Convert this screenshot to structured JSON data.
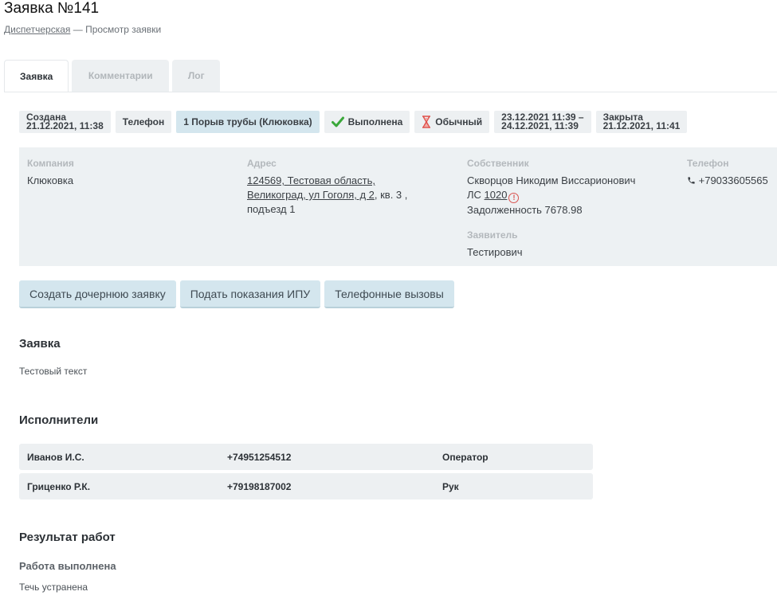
{
  "page": {
    "title": "Заявка №141"
  },
  "breadcrumb": {
    "link": "Диспетчерская",
    "separator": "—",
    "current": "Просмотр заявки"
  },
  "tabs": [
    {
      "label": "Заявка",
      "active": true
    },
    {
      "label": "Комментарии",
      "active": false
    },
    {
      "label": "Лог",
      "active": false
    }
  ],
  "badges": {
    "created_label": "Создана",
    "created_value": "21.12.2021, 11:38",
    "source": "Телефон",
    "category": "1 Порыв трубы (Клюковка)",
    "status": "Выполнена",
    "priority": "Обычный",
    "period_from": "23.12.2021 11:39 –",
    "period_to": "24.12.2021, 11:39",
    "closed_label": "Закрыта",
    "closed_value": "21.12.2021, 11:41",
    "status_icon": "check-icon",
    "priority_icon": "hourglass-icon",
    "status_color": "#3aa83a",
    "priority_color": "#e0504a"
  },
  "info": {
    "company_label": "Компания",
    "company": "Клюковка",
    "address_label": "Адрес",
    "address_link_1": "124569, Тестовая область,",
    "address_link_2": "Великоград, ул Гоголя, д 2",
    "address_rest_1": ", кв. 3 ,",
    "address_rest_2": "подъезд 1",
    "owner_label": "Собственник",
    "owner_name": "Скворцов Никодим Виссарионович",
    "account_prefix": "ЛС",
    "account_number": "1020",
    "debt": "Задолженность 7678.98",
    "applicant_label": "Заявитель",
    "applicant": "Тестирович",
    "phone_label": "Телефон",
    "phone": "+79033605565",
    "phone_icon": "phone-icon"
  },
  "actions": {
    "create_child": "Создать дочернюю заявку",
    "submit_readings": "Подать показания ИПУ",
    "phone_calls": "Телефонные вызовы"
  },
  "request_section": {
    "heading": "Заявка",
    "text": "Тестовый текст"
  },
  "executors": {
    "heading": "Исполнители",
    "rows": [
      {
        "name": "Иванов И.С.",
        "phone": "+74951254512",
        "role": "Оператор"
      },
      {
        "name": "Гриценко Р.К.",
        "phone": "+79198187002",
        "role": "Рук"
      }
    ]
  },
  "result": {
    "heading": "Результат работ",
    "status": "Работа выполнена",
    "text": "Течь устранена"
  }
}
